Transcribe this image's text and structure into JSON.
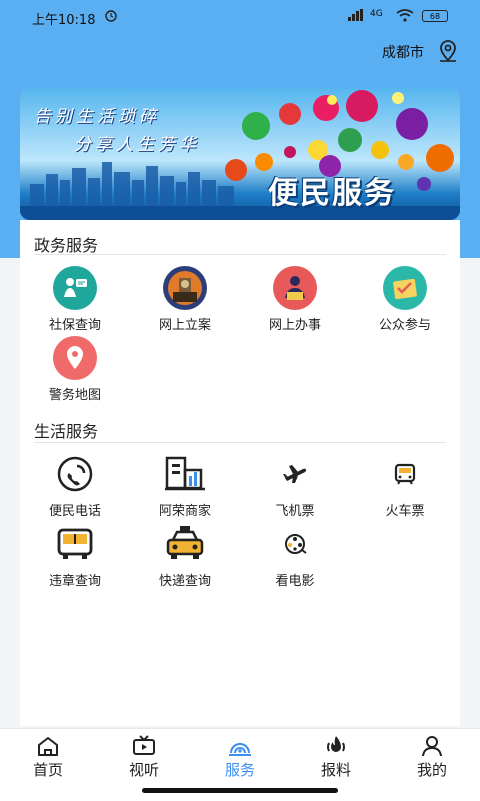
{
  "status": {
    "time": "上午10:18",
    "network": "4G",
    "battery": "68"
  },
  "header": {
    "city": "成都市"
  },
  "banner": {
    "slogan_line1": "告别生活琐碎",
    "slogan_line2": "分享人生芳华",
    "title": "便民服务"
  },
  "gov_section": {
    "title": "政务服务",
    "items": [
      {
        "label": "社保查询",
        "icon": "social-security-icon"
      },
      {
        "label": "网上立案",
        "icon": "court-icon"
      },
      {
        "label": "网上办事",
        "icon": "online-service-icon"
      },
      {
        "label": "公众参与",
        "icon": "public-participation-icon"
      },
      {
        "label": "警务地图",
        "icon": "police-map-icon"
      }
    ]
  },
  "life_section": {
    "title": "生活服务",
    "items": [
      {
        "label": "便民电话",
        "icon": "phone-icon"
      },
      {
        "label": "阿荣商家",
        "icon": "merchant-icon"
      },
      {
        "label": "飞机票",
        "icon": "airplane-icon"
      },
      {
        "label": "火车票",
        "icon": "train-icon"
      },
      {
        "label": "违章查询",
        "icon": "bus-icon"
      },
      {
        "label": "快递查询",
        "icon": "taxi-icon"
      },
      {
        "label": "看电影",
        "icon": "film-reel-icon"
      }
    ]
  },
  "tabs": [
    {
      "label": "首页",
      "icon": "home-icon"
    },
    {
      "label": "视听",
      "icon": "tv-icon"
    },
    {
      "label": "服务",
      "icon": "service-icon",
      "active": true
    },
    {
      "label": "报料",
      "icon": "fire-icon"
    },
    {
      "label": "我的",
      "icon": "user-icon"
    }
  ],
  "colors": {
    "header_bg": "#5aaef2",
    "active_tab": "#3b8ff0"
  }
}
